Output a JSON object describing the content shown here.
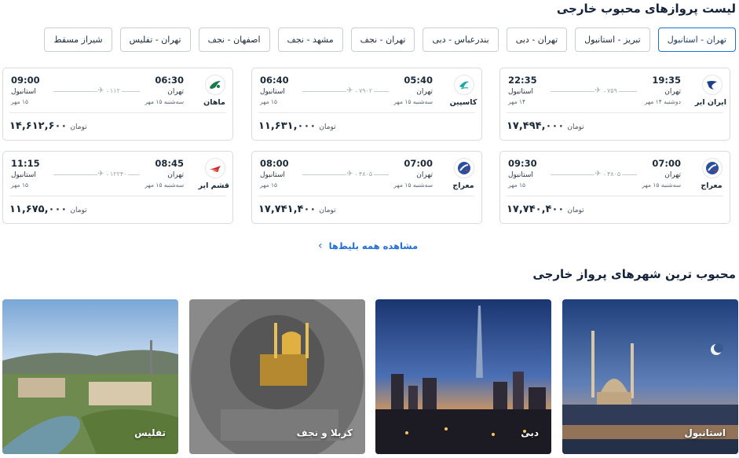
{
  "section1": {
    "title": "لیست پروازهای محبوب خارجی"
  },
  "routes": [
    {
      "label": "تهران - استانبول",
      "active": true
    },
    {
      "label": "تبریز - استانبول",
      "active": false
    },
    {
      "label": "تهران - دبی",
      "active": false
    },
    {
      "label": "بندرعباس - دبی",
      "active": false
    },
    {
      "label": "تهران - نجف",
      "active": false
    },
    {
      "label": "مشهد - نجف",
      "active": false
    },
    {
      "label": "اصفهان - نجف",
      "active": false
    },
    {
      "label": "تهران - تفلیس",
      "active": false
    },
    {
      "label": "شیراز مسقط",
      "active": false
    }
  ],
  "flights": [
    {
      "airline": "ایران ایر",
      "logo_icon": "iranair-logo-icon",
      "logo_color": "#1c3f8a",
      "dep_time": "19:35",
      "dep_city": "تهران",
      "dep_date": "دوشنبه ۱۴ مهر",
      "arr_time": "22:35",
      "arr_city": "استانبول",
      "arr_date": "۱۴ مهر",
      "flight_no": "۷۵۹",
      "price": "۱۷,۴۹۴,۰۰۰",
      "currency": "تومان"
    },
    {
      "airline": "کاسپین",
      "logo_icon": "caspian-logo-icon",
      "logo_color": "#1aa8a8",
      "dep_time": "05:40",
      "dep_city": "تهران",
      "dep_date": "سه‌شنبه ۱۵ مهر",
      "arr_time": "06:40",
      "arr_city": "استانبول",
      "arr_date": "۱۵ مهر",
      "flight_no": "۷۹۰۲",
      "price": "۱۱,۶۳۱,۰۰۰",
      "currency": "تومان"
    },
    {
      "airline": "ماهان",
      "logo_icon": "mahan-logo-icon",
      "logo_color": "#1a7a4a",
      "dep_time": "06:30",
      "dep_city": "تهران",
      "dep_date": "سه‌شنبه ۱۵ مهر",
      "arr_time": "09:00",
      "arr_city": "استانبول",
      "arr_date": "۱۵ مهر",
      "flight_no": "۱۱۲",
      "price": "۱۴,۶۱۲,۶۰۰",
      "currency": "تومان"
    },
    {
      "airline": "معراج",
      "logo_icon": "meraj-logo-icon",
      "logo_color": "#2a4fa0",
      "dep_time": "07:00",
      "dep_city": "تهران",
      "dep_date": "سه‌شنبه ۱۵ مهر",
      "arr_time": "09:30",
      "arr_city": "استانبول",
      "arr_date": "۱۵ مهر",
      "flight_no": "۴۸۰۵",
      "price": "۱۷,۷۴۰,۴۰۰",
      "currency": "تومان"
    },
    {
      "airline": "معراج",
      "logo_icon": "meraj-logo-icon",
      "logo_color": "#2a4fa0",
      "dep_time": "07:00",
      "dep_city": "تهران",
      "dep_date": "سه‌شنبه ۱۵ مهر",
      "arr_time": "08:00",
      "arr_city": "استانبول",
      "arr_date": "۱۵ مهر",
      "flight_no": "۴۸۰۵",
      "price": "۱۷,۷۴۱,۴۰۰",
      "currency": "تومان"
    },
    {
      "airline": "قشم ایر",
      "logo_icon": "qeshmair-logo-icon",
      "logo_color": "#d42a2a",
      "dep_time": "08:45",
      "dep_city": "تهران",
      "dep_date": "سه‌شنبه ۱۵ مهر",
      "arr_time": "11:15",
      "arr_city": "استانبول",
      "arr_date": "۱۵ مهر",
      "flight_no": "۱۲۲۴۰",
      "price": "۱۱,۶۷۵,۰۰۰",
      "currency": "تومان"
    }
  ],
  "see_all": {
    "label": "مشاهده همه بلیط‌ها"
  },
  "section2": {
    "title": "محبوب ترین شهرهای پرواز خارجی"
  },
  "destinations": [
    {
      "name": "استانبول"
    },
    {
      "name": "دبی"
    },
    {
      "name": "کربلا و نجف"
    },
    {
      "name": "تفلیس"
    }
  ],
  "colors": {
    "accent": "#1d6fd8",
    "border": "#d7dbe0",
    "text": "#1b2a3a"
  }
}
